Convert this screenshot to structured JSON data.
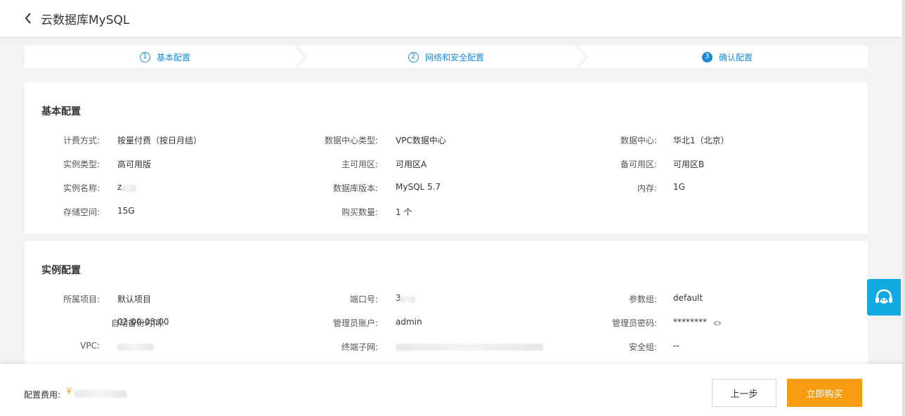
{
  "header": {
    "title": "云数据库MySQL"
  },
  "steps": [
    {
      "num": "1",
      "label": "基本配置"
    },
    {
      "num": "2",
      "label": "网络和安全配置"
    },
    {
      "num": "3",
      "label": "确认配置"
    }
  ],
  "basic": {
    "title": "基本配置",
    "billing_label": "计费方式:",
    "billing_value": "按量付费（按日月结）",
    "dc_type_label": "数据中心类型:",
    "dc_type_value": "VPC数据中心",
    "dc_label": "数据中心:",
    "dc_value": "华北1（北京）",
    "instance_type_label": "实例类型:",
    "instance_type_value": "高可用版",
    "primary_zone_label": "主可用区:",
    "primary_zone_value": "可用区A",
    "backup_zone_label": "备可用区:",
    "backup_zone_value": "可用区B",
    "instance_name_label": "实例名称:",
    "instance_name_value": "z",
    "db_version_label": "数据库版本:",
    "db_version_value": "MySQL 5.7",
    "memory_label": "内存:",
    "memory_value": "1G",
    "storage_label": "存储空间:",
    "storage_value": "15G",
    "quantity_label": "购买数量:",
    "quantity_value": "1 个"
  },
  "instance": {
    "title": "实例配置",
    "project_label": "所属项目:",
    "project_value": "默认项目",
    "port_label": "端口号:",
    "port_value": "3",
    "param_group_label": "参数组:",
    "param_group_value": "default",
    "backup_time_label": "自动备份时间:",
    "backup_time_value": "02:00-03:00",
    "admin_account_label": "管理员账户:",
    "admin_account_value": "admin",
    "admin_password_label": "管理员密码:",
    "admin_password_value": "********",
    "vpc_label": "VPC:",
    "vpc_value": "",
    "subnet_label": "终端子网:",
    "subnet_value": "",
    "security_group_label": "安全组:",
    "security_group_value": "--"
  },
  "footer": {
    "fee_label": "配置费用:",
    "fee_symbol": "¥",
    "prev_label": "上一步",
    "buy_label": "立即购买"
  },
  "colors": {
    "accent": "#1b8ad6",
    "buy": "#f79b0f",
    "float": "#12a8e0"
  },
  "icons": {
    "back": "chevron-left-icon",
    "eye": "eye-icon",
    "float": "customer-service-icon"
  }
}
